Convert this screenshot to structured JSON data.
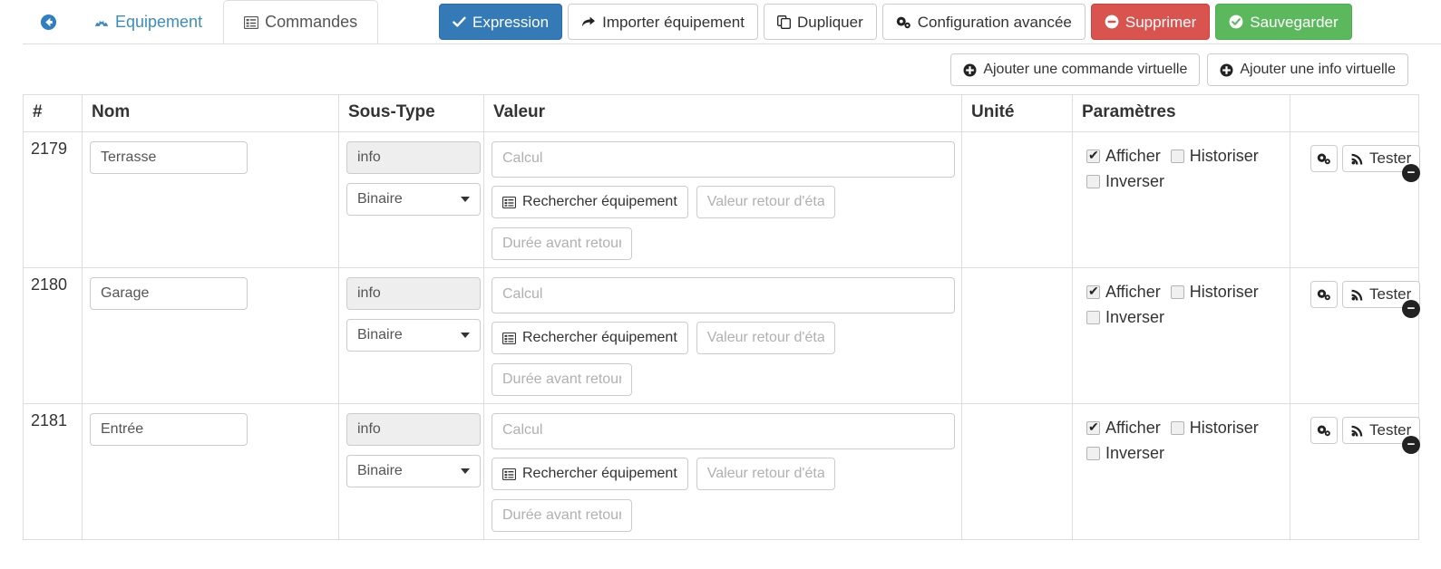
{
  "tabs": {
    "back_icon": "back-circle-icon",
    "items": [
      {
        "label": "Equipement",
        "icon": "dashboard-icon",
        "active": false
      },
      {
        "label": "Commandes",
        "icon": "list-alt-icon",
        "active": true
      }
    ]
  },
  "toolbar": {
    "buttons": [
      {
        "label": "Expression",
        "icon": "check-icon",
        "style": "primary"
      },
      {
        "label": "Importer équipement",
        "icon": "share-icon",
        "style": "default"
      },
      {
        "label": "Dupliquer",
        "icon": "copy-icon",
        "style": "default"
      },
      {
        "label": "Configuration avancée",
        "icon": "cogs-icon",
        "style": "default"
      },
      {
        "label": "Supprimer",
        "icon": "minus-circle-icon",
        "style": "danger"
      },
      {
        "label": "Sauvegarder",
        "icon": "check-circle-icon",
        "style": "success"
      }
    ]
  },
  "addbar": {
    "buttons": [
      {
        "label": "Ajouter une commande virtuelle",
        "icon": "plus-circle-icon"
      },
      {
        "label": "Ajouter une info virtuelle",
        "icon": "plus-circle-icon"
      }
    ]
  },
  "table": {
    "headers": [
      "#",
      "Nom",
      "Sous-Type",
      "Valeur",
      "Unité",
      "Paramètres",
      ""
    ],
    "placeholders": {
      "calcul": "Calcul",
      "valeur_retour": "Valeur retour d'état",
      "duree": "Durée avant retour"
    },
    "labels": {
      "search_equipment": "Rechercher équipement",
      "search_icon": "list-alt-icon",
      "test": "Tester",
      "test_icon": "rss-icon",
      "config_icon": "cogs-icon",
      "remove_icon": "minus-circle-icon",
      "afficher": "Afficher",
      "historiser": "Historiser",
      "inverser": "Inverser"
    },
    "rows": [
      {
        "id": "2179",
        "nom": "Terrasse",
        "type": "info",
        "sous_type": "Binaire",
        "unite": "",
        "afficher": true,
        "historiser": false,
        "inverser": false
      },
      {
        "id": "2180",
        "nom": "Garage",
        "type": "info",
        "sous_type": "Binaire",
        "unite": "",
        "afficher": true,
        "historiser": false,
        "inverser": false
      },
      {
        "id": "2181",
        "nom": "Entrée",
        "type": "info",
        "sous_type": "Binaire",
        "unite": "",
        "afficher": true,
        "historiser": false,
        "inverser": false
      }
    ]
  },
  "colors": {
    "primary": "#337ab7",
    "danger": "#d9534f",
    "success": "#5cb85c",
    "tab_link": "#3c8dbc",
    "border": "#dddddd"
  }
}
